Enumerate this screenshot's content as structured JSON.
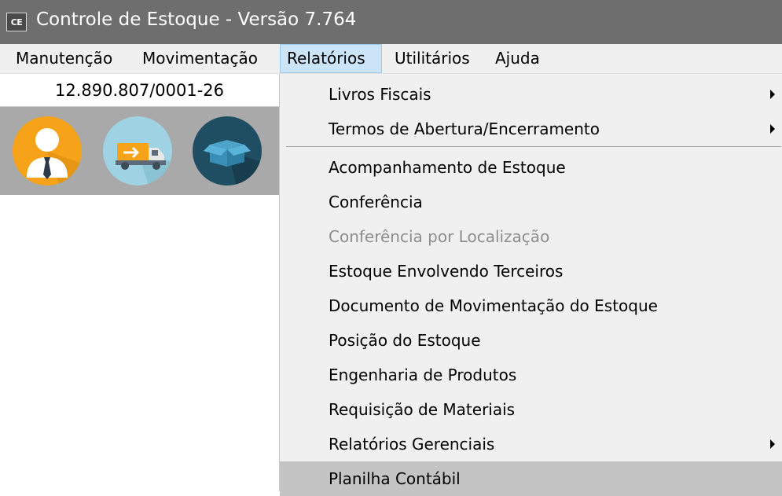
{
  "window": {
    "app_icon_text": "CE",
    "title": "Controle de Estoque - Versão 7.764"
  },
  "menubar": {
    "items": [
      {
        "label": "Manutenção"
      },
      {
        "label": "Movimentação"
      },
      {
        "label": "Relatórios",
        "active": true
      },
      {
        "label": "Utilitários"
      },
      {
        "label": "Ajuda"
      }
    ]
  },
  "company": {
    "cnpj": "12.890.807/0001-26"
  },
  "toolbar_icons": [
    {
      "name": "user-icon",
      "color": "#f6a31a"
    },
    {
      "name": "delivery-truck-icon",
      "color": "#9fd3e4"
    },
    {
      "name": "box-icon",
      "color": "#1f4e63"
    }
  ],
  "dropdown": {
    "items": [
      {
        "label": "Livros Fiscais",
        "submenu": true
      },
      {
        "label": "Termos de Abertura/Encerramento",
        "submenu": true
      },
      {
        "label": "Acompanhamento de Estoque"
      },
      {
        "label": "Conferência"
      },
      {
        "label": "Conferência por Localização",
        "disabled": true
      },
      {
        "label": "Estoque Envolvendo Terceiros"
      },
      {
        "label": "Documento de Movimentação do Estoque"
      },
      {
        "label": "Posição do Estoque"
      },
      {
        "label": "Engenharia de Produtos"
      },
      {
        "label": "Requisição de Materiais"
      },
      {
        "label": "Relatórios Gerenciais",
        "submenu": true
      },
      {
        "label": "Planilha Contábil",
        "highlighted": true
      }
    ]
  }
}
